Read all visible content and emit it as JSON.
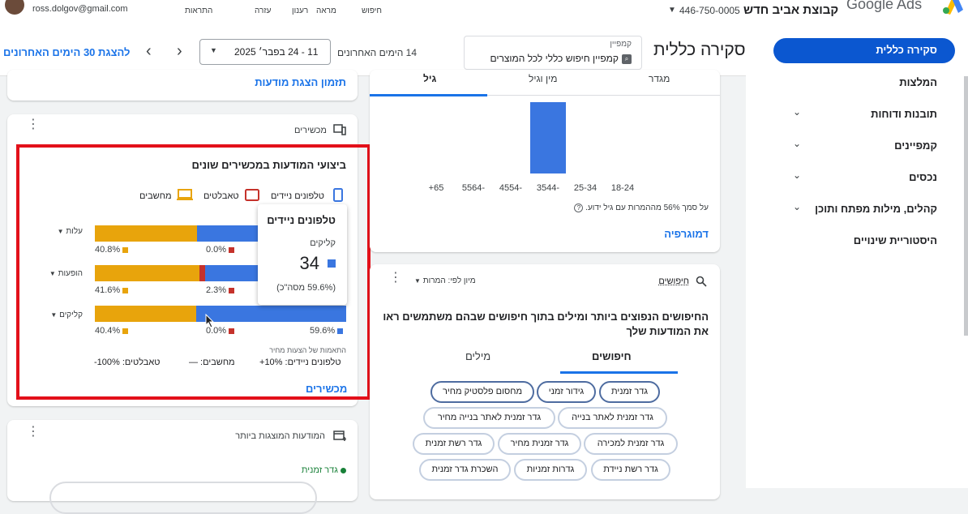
{
  "topbar": {
    "email": "ross.dolgov@gmail.com",
    "nav": [
      "חיפוש",
      "מראה",
      "רענון",
      "עזרה",
      "התראות"
    ],
    "account_id": "446-750-0005",
    "account_name": "קבוצת אביב חדש",
    "product_name": "Google Ads"
  },
  "subbar": {
    "page_title": "סקירה כללית",
    "campaign_label": "קמפיין",
    "campaign_value": "קמפיין חיפוש כללי לכל המוצרים",
    "date_range_label": "14 הימים האחרונים",
    "date_range_value": "11 - 24 בפבר׳ 2025",
    "show_last_30": "להצגת 30 הימים האחרונים"
  },
  "sidebar": {
    "items": [
      "סקירה כללית",
      "המלצות",
      "תובנות ודוחות",
      "קמפיינים",
      "נכסים",
      "קהלים, מילות מפתח ותוכן",
      "היסטוריית שינויים"
    ]
  },
  "ad_schedule_card": {
    "link": "תזמון הצגת מודעות"
  },
  "devices_card": {
    "header": "מכשירים",
    "title": "ביצועי המודעות במכשירים שונים",
    "legend": [
      "טלפונים ניידים",
      "טאבלטים",
      "מחשבים"
    ],
    "rows": [
      {
        "metric": "עלות",
        "mobile_pct": "",
        "tablet_pct": "0.0%",
        "computer_pct": "40.8%"
      },
      {
        "metric": "הופעות",
        "mobile_pct": "",
        "tablet_pct": "2.3%",
        "computer_pct": "41.6%"
      },
      {
        "metric": "קליקים",
        "mobile_pct": "59.6%",
        "tablet_pct": "0.0%",
        "computer_pct": "40.4%"
      }
    ],
    "bar_shares": [
      {
        "mobile": 0.592,
        "tablet": 0.0,
        "computer": 0.408
      },
      {
        "mobile": 0.561,
        "tablet": 0.023,
        "computer": 0.416
      },
      {
        "mobile": 0.596,
        "tablet": 0.0,
        "computer": 0.404
      }
    ],
    "bid_adjust_label": "התאמות של הצעות מחיר",
    "bid_mobile": "טלפונים ניידים: 10%+",
    "bid_computers": "מחשבים: —",
    "bid_tablets": "טאבלטים: 100%-",
    "footer_link": "מכשירים",
    "tooltip": {
      "title": "טלפונים ניידים",
      "metric": "קליקים",
      "value": "34",
      "share": "(59.6% מסה\"כ)"
    }
  },
  "top_ads_card": {
    "header": "המודעות המוצגות ביותר",
    "item": "גדר זמנית"
  },
  "demographics_card": {
    "tabs": [
      "מגדר",
      "מין וגיל",
      "גיל"
    ],
    "chart_data": {
      "type": "bar",
      "categories": [
        "18-24",
        "25-34",
        "3544-",
        "4554-",
        "5564-",
        "+65"
      ],
      "values": [
        0,
        0,
        100,
        0,
        0,
        0
      ]
    },
    "note": "על סמך 56% מההמרות עם גיל ידוע.",
    "link": "דמוגרפיה"
  },
  "searches_card": {
    "header": "חיפושים",
    "sort_label": "מיון לפי:",
    "sort_value": "המרות",
    "title": "החיפושים הנפוצים ביותר ומילים בתוך חיפושים שבהם משתמשים ראו את המודעות שלך",
    "tabs": [
      "חיפושים",
      "מילים"
    ],
    "chips": [
      "גדר זמנית",
      "גידור זמני",
      "מחסום פלסטיק מחיר",
      "גדר זמנית לאתר בנייה",
      "גדר זמנית לאתר בנייה מחיר",
      "גדר זמנית למכירה",
      "גדר זמנית מחיר",
      "גדר רשת זמנית",
      "גדר רשת ניידת",
      "גדרות זמניות",
      "השכרת גדר זמנית"
    ]
  },
  "colors": {
    "mobile": "#3a76e0",
    "tablet": "#c5322b",
    "computer": "#e8a40c",
    "highlight": "#e3101a",
    "accent": "#1a73e8"
  }
}
